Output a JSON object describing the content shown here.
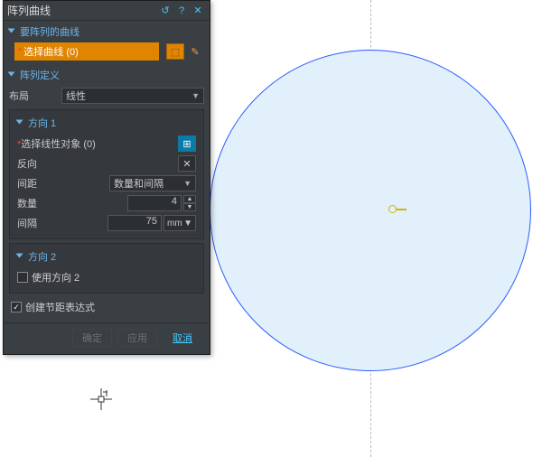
{
  "dialog": {
    "title": "阵列曲线",
    "sections": {
      "curves": {
        "header": "要阵列的曲线",
        "select_label": "选择曲线 (0)"
      },
      "definition": {
        "header": "阵列定义",
        "layout_label": "布局",
        "layout_value": "线性"
      },
      "dir1": {
        "header": "方向 1",
        "select_linear_label": "选择线性对象 (0)",
        "reverse_label": "反向",
        "spacing_label": "间距",
        "spacing_value": "数量和间隔",
        "count_label": "数量",
        "count_value": "4",
        "gap_label": "间隔",
        "gap_value": "75",
        "gap_unit": "mm"
      },
      "dir2": {
        "header": "方向 2",
        "use_dir2_label": "使用方向 2"
      },
      "expr": {
        "create_expr_label": "创建节距表达式"
      }
    },
    "buttons": {
      "ok": "确定",
      "apply": "应用",
      "cancel": "取消"
    }
  }
}
